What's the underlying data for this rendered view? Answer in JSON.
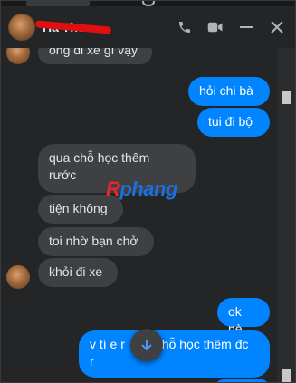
{
  "header": {
    "contact_name": "Ha Thu",
    "icons": [
      "phone-icon",
      "video-icon",
      "minimize-icon",
      "close-icon"
    ]
  },
  "messages": [
    {
      "side": "in",
      "text": "ông đi xe gì vậy"
    },
    {
      "side": "out",
      "text": "hỏi chi bà"
    },
    {
      "side": "out",
      "text": "tui đi bộ"
    },
    {
      "side": "in",
      "line1": "qua chỗ học thêm",
      "line2": "rước"
    },
    {
      "side": "in",
      "text": "tiện không"
    },
    {
      "side": "in",
      "text": "toi nhờ bạn chở"
    },
    {
      "side": "in",
      "text": "khỏi đi xe"
    },
    {
      "side": "out",
      "text": "ok nè"
    },
    {
      "side": "out",
      "line1": "v tí e r",
      "line1b": "chỗ học thêm đc",
      "line2": "r"
    }
  ],
  "watermark": {
    "part1": "R",
    "part2": "phang"
  },
  "colors": {
    "outgoing": "#0084ff",
    "incoming": "#3e4042",
    "background": "#242526",
    "icons": "#b0b3b8"
  }
}
